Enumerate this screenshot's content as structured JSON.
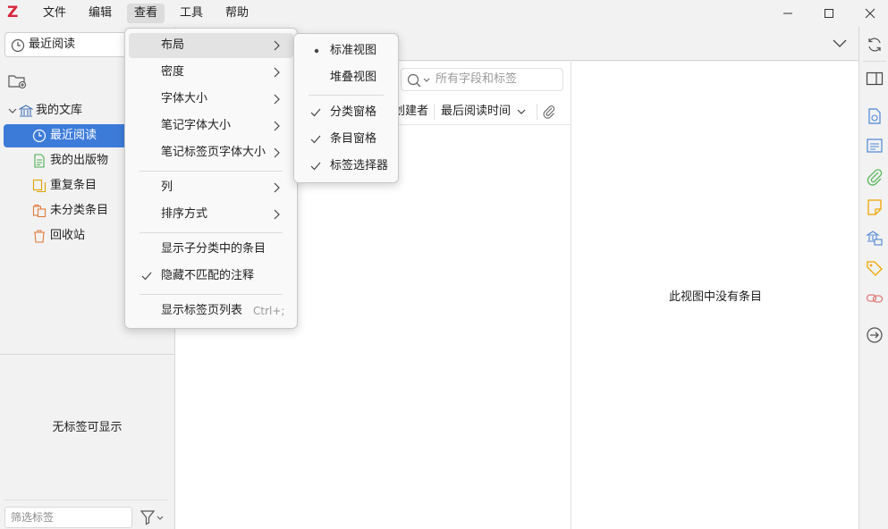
{
  "app": {
    "logo": "Z",
    "menubar": [
      "文件",
      "编辑",
      "查看",
      "工具",
      "帮助"
    ],
    "active_menu": "查看"
  },
  "left_pane": {
    "library_selector": "最近阅读",
    "tree": {
      "library": "我的文库",
      "items": [
        "最近阅读",
        "我的出版物",
        "重复条目",
        "未分类条目",
        "回收站"
      ],
      "selected": "最近阅读"
    },
    "tag_selector": {
      "empty_text": "无标签可显示",
      "filter_placeholder": "筛选标签"
    }
  },
  "items_pane": {
    "search_placeholder": "所有字段和标签",
    "columns": [
      "创建者",
      "最后阅读时间"
    ]
  },
  "item_pane": {
    "empty_message": "此视图中没有条目"
  },
  "view_menu": {
    "items": [
      {
        "label": "布局",
        "submenu": true
      },
      {
        "label": "密度",
        "submenu": true
      },
      {
        "label": "字体大小",
        "submenu": true
      },
      {
        "label": "笔记字体大小",
        "submenu": true
      },
      {
        "label": "笔记标签页字体大小",
        "submenu": true
      },
      {
        "label": "列",
        "submenu": true
      },
      {
        "label": "排序方式",
        "submenu": true
      },
      {
        "label": "显示子分类中的条目",
        "checked": false
      },
      {
        "label": "隐藏不匹配的注释",
        "checked": true
      },
      {
        "label": "显示标签页列表",
        "shortcut": "Ctrl+;"
      }
    ]
  },
  "layout_submenu": {
    "items": [
      {
        "label": "标准视图",
        "mark": "radio"
      },
      {
        "label": "堆叠视图",
        "mark": "none"
      },
      {
        "label": "分类窗格",
        "mark": "check"
      },
      {
        "label": "条目窗格",
        "mark": "check"
      },
      {
        "label": "标签选择器",
        "mark": "check"
      }
    ]
  },
  "colors": {
    "accent": "#3d7bd9",
    "logo_red": "#d7263d"
  }
}
